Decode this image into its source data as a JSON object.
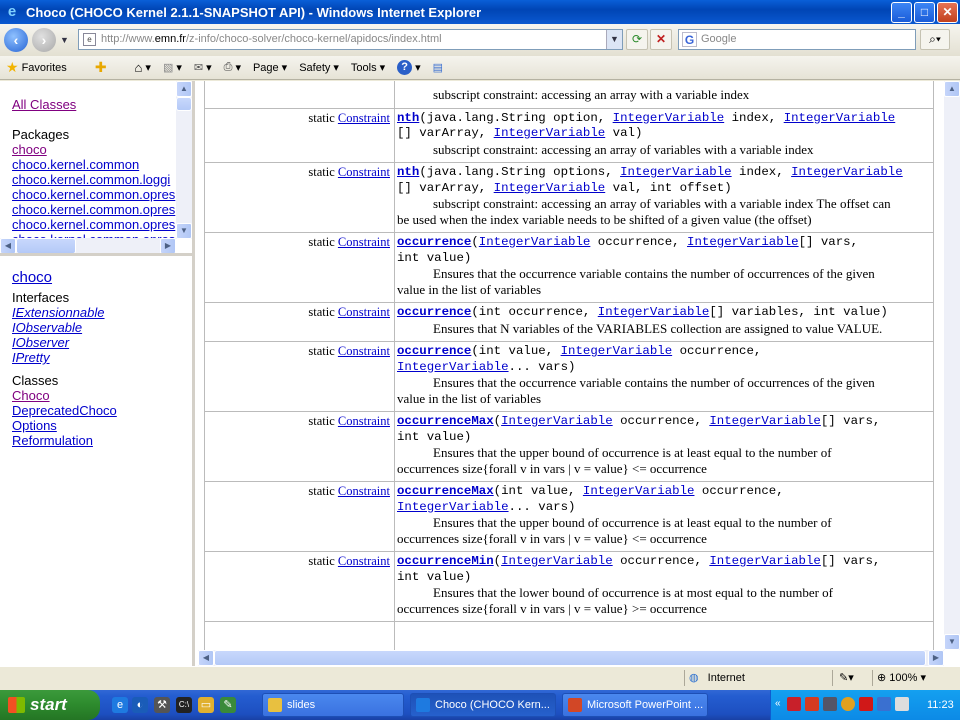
{
  "window": {
    "title": "Choco (CHOCO Kernel 2.1.1-SNAPSHOT API) - Windows Internet Explorer",
    "min": "_",
    "max": "□",
    "close": "✕"
  },
  "address": {
    "prefix": "http://www.",
    "host": "emn.fr",
    "path": "/z-info/choco-solver/choco-kernel/apidocs/index.html",
    "search_placeholder": "Google"
  },
  "favbar": {
    "favorites": "Favorites",
    "page": "Page",
    "safety": "Safety",
    "tools": "Tools"
  },
  "left_top": {
    "all_classes": "All Classes",
    "packages_heading": "Packages",
    "packages": [
      "choco",
      "choco.kernel.common",
      "choco.kernel.common.loggi",
      "choco.kernel.common.opres",
      "choco.kernel.common.opres",
      "choco.kernel.common.opres",
      "choco.kernel.common.opres"
    ]
  },
  "left_bottom": {
    "package_title": "choco",
    "interfaces_heading": "Interfaces",
    "interfaces": [
      "IExtensionnable",
      "IObservable",
      "IObserver",
      "IPretty"
    ],
    "classes_heading": "Classes",
    "classes": [
      "Choco",
      "DeprecatedChoco",
      "Options",
      "Reformulation"
    ]
  },
  "members": {
    "modifier": "static",
    "return_type": "Constraint",
    "rows": [
      {
        "head": "",
        "desc": "subscript constraint: accessing an array with a variable index"
      },
      {
        "name": "nth",
        "sig1a": "(java.lang.String option, ",
        "t1": "IntegerVariable",
        "sig1b": " index, ",
        "t2": "IntegerVariable",
        "sig2a": "[] varArray, ",
        "t3": "IntegerVariable",
        "sig2b": " val)",
        "desc": "subscript constraint: accessing an array of variables with a variable index"
      },
      {
        "name": "nth",
        "sig1a": "(java.lang.String options, ",
        "t1": "IntegerVariable",
        "sig1b": " index, ",
        "t2": "IntegerVariable",
        "sig2a": "[] varArray, ",
        "t3": "IntegerVariable",
        "sig2b": " val, int offset)",
        "desc": "subscript constraint: accessing an array of variables with a variable index The offset can",
        "desc2": "be used when the index variable needs to be shifted of a given value (the offset)"
      },
      {
        "name": "occurrence",
        "sig1a": "(",
        "t1": "IntegerVariable",
        "sig1b": " occurrence, ",
        "t2": "IntegerVariable",
        "sig1c": "[] vars,",
        "sig2": "int value)",
        "desc": "Ensures that the occurrence variable contains the number of occurrences of the given",
        "desc2": "value in the list of variables"
      },
      {
        "name": "occurrence",
        "sig1a": "(int occurrence, ",
        "t1": "IntegerVariable",
        "sig1b": "[] variables, int value)",
        "desc": "Ensures that N variables of the VARIABLES collection are assigned to value VALUE."
      },
      {
        "name": "occurrence",
        "sig1a": "(int value, ",
        "t1": "IntegerVariable",
        "sig1b": " occurrence,",
        "t2": "IntegerVariable",
        "sig2": "... vars)",
        "desc": "Ensures that the occurrence variable contains the number of occurrences of the given",
        "desc2": "value in the list of variables"
      },
      {
        "name": "occurrenceMax",
        "sig1a": "(",
        "t1": "IntegerVariable",
        "sig1b": " occurrence, ",
        "t2": "IntegerVariable",
        "sig1c": "[] vars,",
        "sig2": "int value)",
        "desc": "Ensures that the upper bound of occurrence is at least equal to the number of",
        "desc2": "occurrences size{forall v in vars | v = value} <= occurrence"
      },
      {
        "name": "occurrenceMax",
        "sig1a": "(int value, ",
        "t1": "IntegerVariable",
        "sig1b": " occurrence,",
        "t2": "IntegerVariable",
        "sig2": "... vars)",
        "desc": "Ensures that the upper bound of occurrence is at least equal to the number of",
        "desc2": "occurrences size{forall v in vars | v = value} <= occurrence"
      },
      {
        "name": "occurrenceMin",
        "sig1a": "(",
        "t1": "IntegerVariable",
        "sig1b": " occurrence, ",
        "t2": "IntegerVariable",
        "sig1c": "[] vars,",
        "sig2": "int value)",
        "desc": "Ensures that the lower bound of occurrence is at most equal to the number of",
        "desc2": "occurrences size{forall v in vars | v = value} >= occurrence"
      }
    ]
  },
  "status": {
    "zone": "Internet",
    "zoom": "100%"
  },
  "taskbar": {
    "start": "start",
    "tasks": [
      "slides",
      "Choco (CHOCO Kern...",
      "Microsoft PowerPoint ..."
    ],
    "clock": "11:23"
  }
}
